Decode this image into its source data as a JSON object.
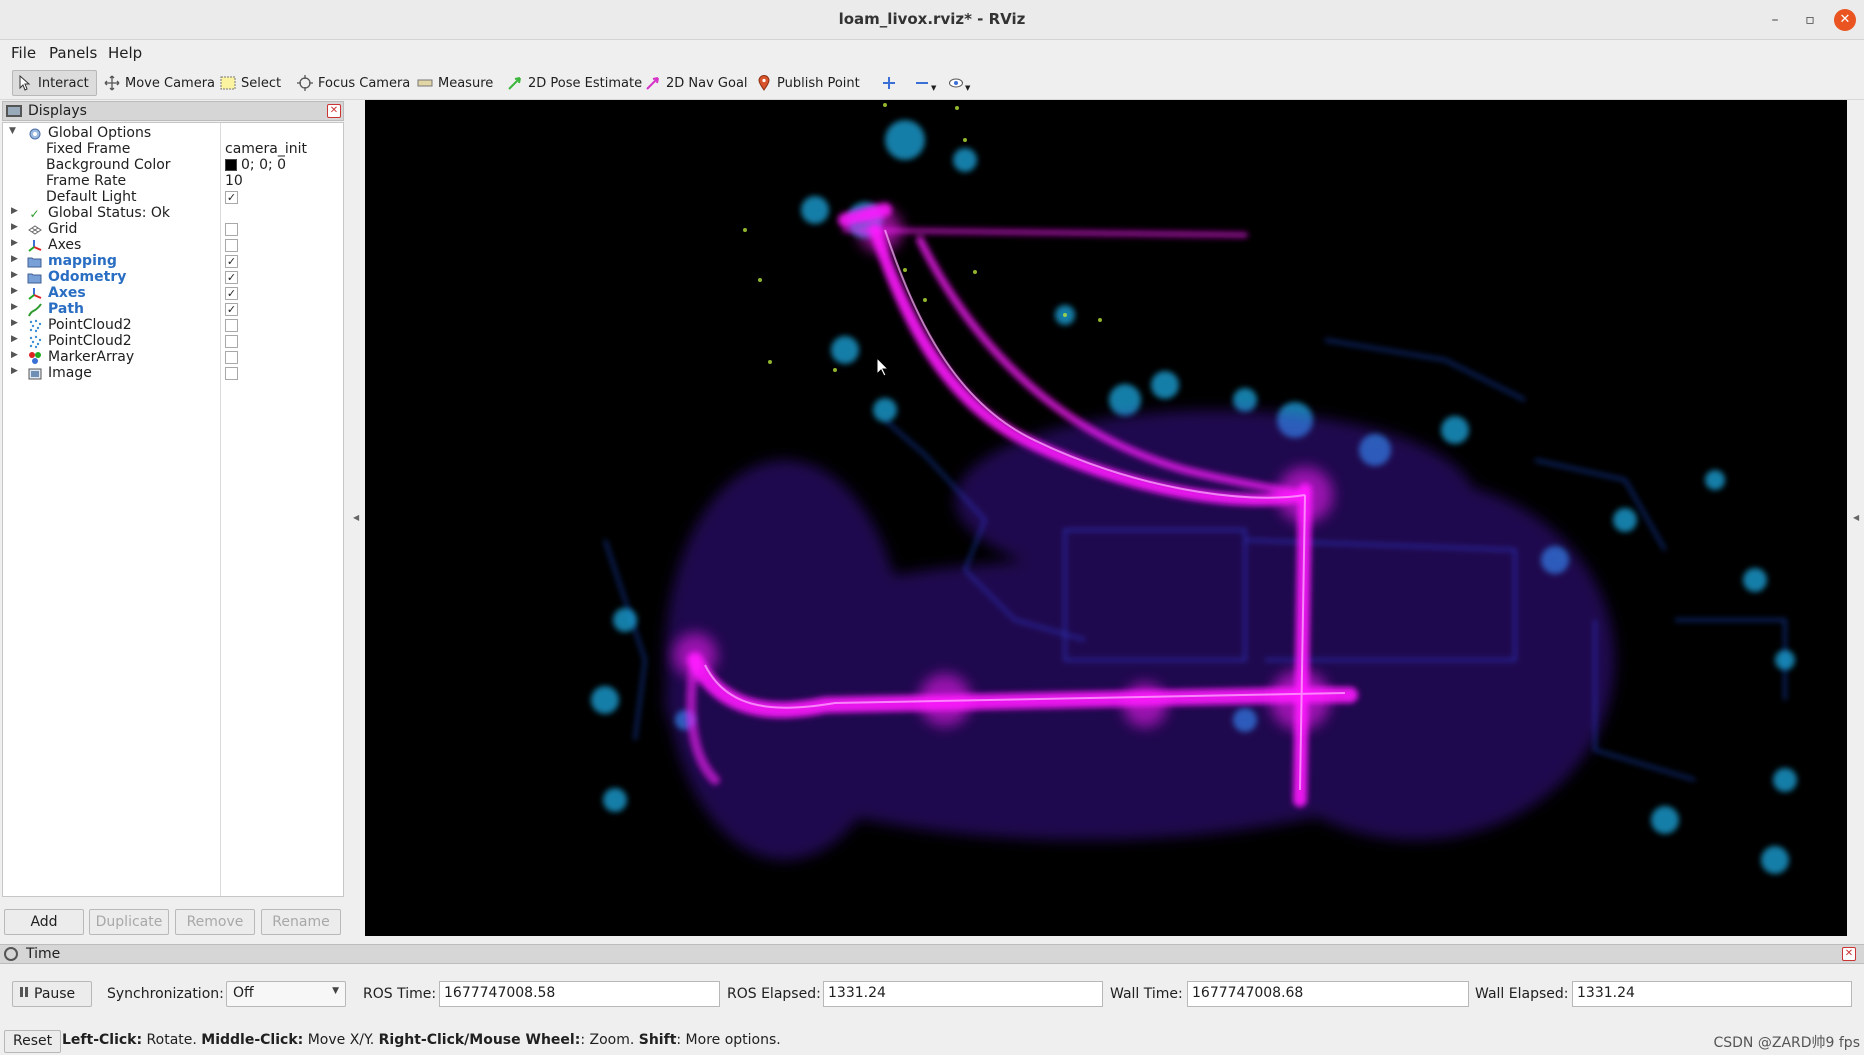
{
  "window": {
    "title": "loam_livox.rviz* - RViz",
    "minimize": "–",
    "maximize": "▫",
    "close": "✕"
  },
  "menubar": {
    "items": [
      {
        "label": "File"
      },
      {
        "label": "Panels"
      },
      {
        "label": "Help"
      }
    ]
  },
  "toolbar": {
    "tools": [
      {
        "label": "Interact"
      },
      {
        "label": "Move Camera"
      },
      {
        "label": "Select"
      },
      {
        "label": "Focus Camera"
      },
      {
        "label": "Measure"
      },
      {
        "label": "2D Pose Estimate"
      },
      {
        "label": "2D Nav Goal"
      },
      {
        "label": "Publish Point"
      }
    ]
  },
  "displays": {
    "title": "Displays",
    "rows": [
      {
        "name": "Global Options",
        "value": ""
      },
      {
        "name": "Fixed Frame",
        "value": "camera_init"
      },
      {
        "name": "Background Color",
        "value": "0; 0; 0"
      },
      {
        "name": "Frame Rate",
        "value": "10"
      },
      {
        "name": "Default Light",
        "checked": "✓"
      },
      {
        "name": "Global Status: Ok"
      },
      {
        "name": "Grid",
        "checked": ""
      },
      {
        "name": "Axes",
        "checked": ""
      },
      {
        "name": "mapping",
        "checked": "✓"
      },
      {
        "name": "Odometry",
        "checked": "✓"
      },
      {
        "name": "Axes",
        "checked": "✓"
      },
      {
        "name": "Path",
        "checked": "✓"
      },
      {
        "name": "PointCloud2",
        "checked": ""
      },
      {
        "name": "PointCloud2",
        "checked": ""
      },
      {
        "name": "MarkerArray",
        "checked": ""
      },
      {
        "name": "Image",
        "checked": ""
      }
    ],
    "buttons": {
      "add": "Add",
      "duplicate": "Duplicate",
      "remove": "Remove",
      "rename": "Rename"
    }
  },
  "time_panel": {
    "title": "Time",
    "pause": "Pause",
    "sync_label": "Synchronization:",
    "sync_value": "Off",
    "ros_time_label": "ROS Time:",
    "ros_time": "1677747008.58",
    "ros_elapsed_label": "ROS Elapsed:",
    "ros_elapsed": "1331.24",
    "wall_time_label": "Wall Time:",
    "wall_time": "1677747008.68",
    "wall_elapsed_label": "Wall Elapsed:",
    "wall_elapsed": "1331.24"
  },
  "statusbar": {
    "reset": "Reset",
    "hint_1b": "Left-Click:",
    "hint_1": " Rotate. ",
    "hint_2b": "Middle-Click:",
    "hint_2": " Move X/Y. ",
    "hint_3b": "Right-Click/Mouse Wheel:",
    "hint_3": ": Zoom. ",
    "hint_4b": "Shift",
    "hint_4": ": More options.",
    "watermark": "CSDN @ZARD帅9 fps"
  },
  "colors": {
    "accent_close": "#e95420",
    "display_blue": "#2a6ec3",
    "viewport_bg": "#000000",
    "points_magenta": "#ff1aff",
    "points_violet": "#7a2cff",
    "points_blue": "#1e6bff",
    "points_cyan": "#20b8e0",
    "points_green": "#b6e23a"
  }
}
